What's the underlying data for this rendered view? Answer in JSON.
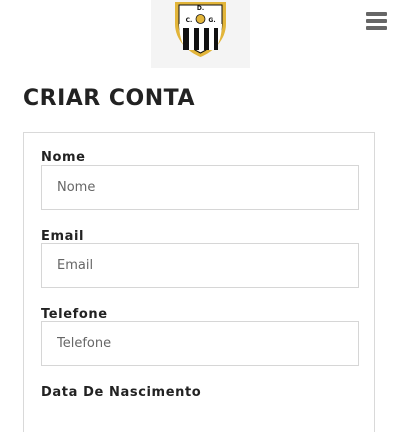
{
  "header": {
    "logo": {
      "icon": "club-crest-icon",
      "crest_text": "D. C. G.",
      "colors": {
        "gold": "#e2b53a",
        "black": "#111111",
        "white": "#ffffff"
      }
    },
    "menu_icon": "hamburger-menu-icon"
  },
  "page": {
    "title": "CRIAR CONTA"
  },
  "form": {
    "fields": [
      {
        "label": "Nome",
        "placeholder": "Nome",
        "value": ""
      },
      {
        "label": "Email",
        "placeholder": "Email",
        "value": ""
      },
      {
        "label": "Telefone",
        "placeholder": "Telefone",
        "value": ""
      },
      {
        "label": "Data De Nascimento"
      }
    ]
  }
}
